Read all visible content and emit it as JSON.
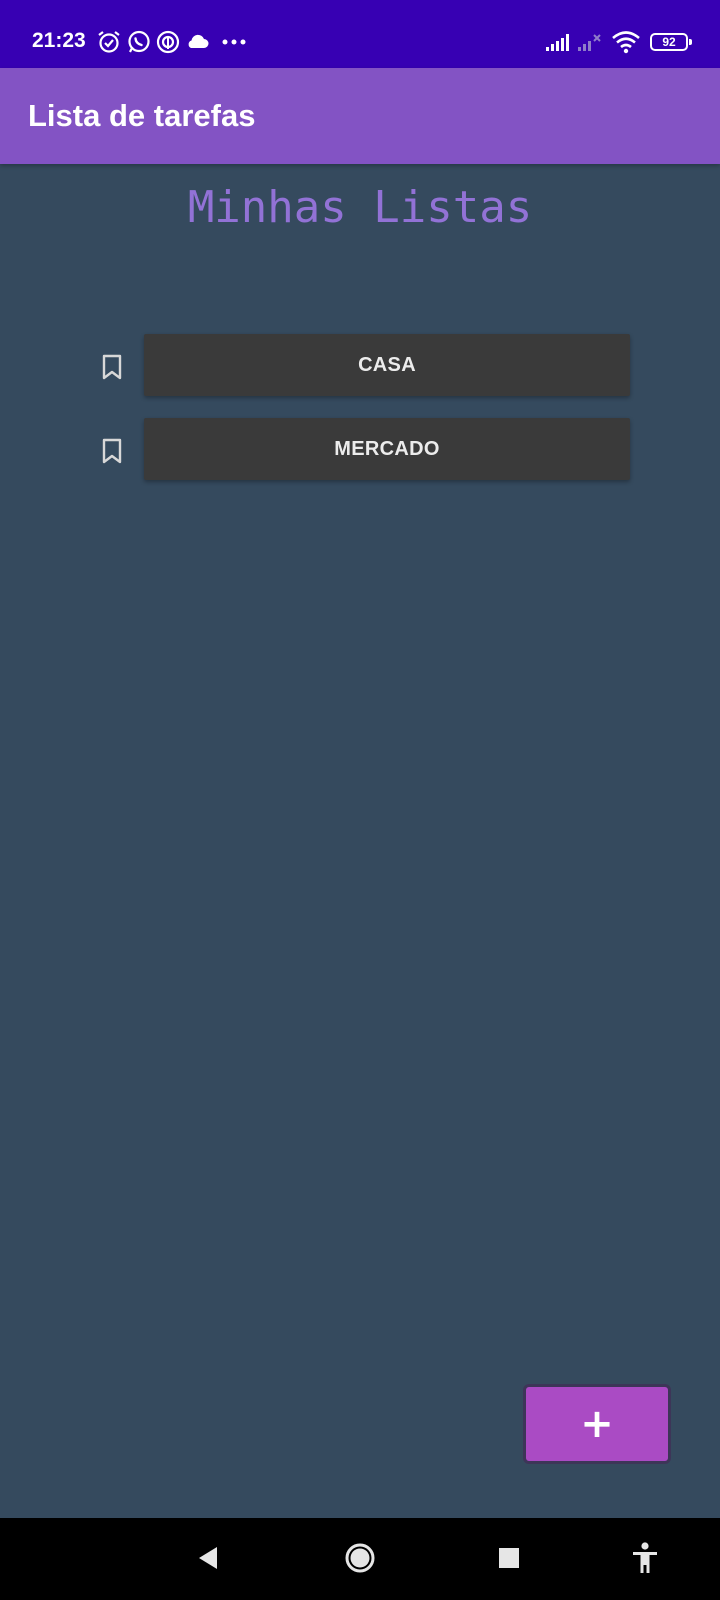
{
  "status_bar": {
    "time": "21:23",
    "battery": "92",
    "icons": [
      "alarm-icon",
      "whatsapp-icon",
      "app-icon",
      "cloud-icon",
      "more-dots-icon",
      "signal-icon",
      "signal-no-service-icon",
      "wifi-icon",
      "battery-icon"
    ]
  },
  "app_bar": {
    "title": "Lista de tarefas"
  },
  "main": {
    "heading": "Minhas Listas",
    "lists": [
      {
        "label": "CASA",
        "icon": "bookmark-icon"
      },
      {
        "label": "MERCADO",
        "icon": "bookmark-icon"
      }
    ]
  },
  "fab": {
    "label": "+"
  },
  "nav_bar": {
    "buttons": [
      "back-icon",
      "home-icon",
      "recents-icon",
      "accessibility-icon"
    ]
  },
  "colors": {
    "status_bar": "#3700b3",
    "app_bar": "#8353c4",
    "background": "#354a5e",
    "heading": "#9272d6",
    "list_button": "#3a3a3a",
    "fab": "#aa4bc4"
  }
}
